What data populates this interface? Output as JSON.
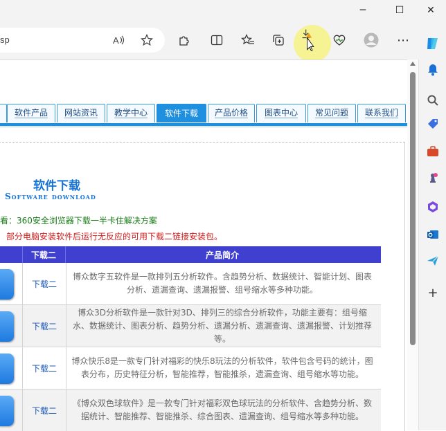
{
  "browser": {
    "address_text": "sp",
    "window_controls": {
      "minimize": "─",
      "maximize": "☐",
      "close": "✕"
    },
    "toolbar_icons": [
      "read-aloud-icon",
      "favorite-star-icon",
      "extensions-icon",
      "split-screen-icon",
      "favorites-icon",
      "collections-icon",
      "downloads-icon",
      "browser-essentials-icon",
      "profile-icon",
      "more-icon"
    ],
    "sidebar_icons": [
      "copilot-icon",
      "bell-icon",
      "search-icon",
      "shopping-tag-icon",
      "tools-icon",
      "games-icon",
      "microsoft365-icon",
      "outlook-icon",
      "send-icon",
      "add-icon"
    ]
  },
  "nav": {
    "tabs": [
      "软件产品",
      "网站资讯",
      "教学中心",
      "软件下载",
      "产品价格",
      "图表中心",
      "常见问题",
      "联系我们"
    ],
    "active": "软件下载"
  },
  "section": {
    "title": "软件下载",
    "subtitle": "Software download",
    "note1": "看：360安全浏览器下载一半卡住解决方案",
    "note2": "部分电脑安装软件后运行无反应的可用下载二链接安装包。"
  },
  "table": {
    "headers": {
      "download2": "下载二",
      "intro": "产品简介"
    },
    "rows": [
      {
        "link": "下载二",
        "desc": "博众数字五软件是一款排列五分析软件。含趋势分析、数据统计、智能计划、图表分析、遗漏查询、遗漏报警、组号缩水等多种功能。"
      },
      {
        "link": "下载二",
        "desc": "博众3D分析软件是一款针对3D、排列三的综合分析软件，功能主要有：组号缩水、数据统计、图表分析、趋势分析、遗漏分析、遗漏查询、遗漏报警、计划推荐等。"
      },
      {
        "link": "下载二",
        "desc": "博众快乐8是一款专门针对福彩的快乐8玩法的分析软件，软件包含号码的统计，图表分布，历史特征分析，智能推荐，智能推杀，遗漏查询、组号缩水等功能。"
      },
      {
        "link": "下载二",
        "desc": "《博众双色球软件》是一款专门针对福彩双色球玩法的分析软件、含趋势分析、数据统计、智能推荐、智能推杀、综合图表、遗漏查询、组号缩水等多种功能。"
      }
    ]
  },
  "colors": {
    "nav_active": "#1f8fe0",
    "table_header": "#3f3fd0",
    "title": "#1573d6",
    "note_green": "#1a7d1a",
    "note_red": "#d11d1d"
  }
}
